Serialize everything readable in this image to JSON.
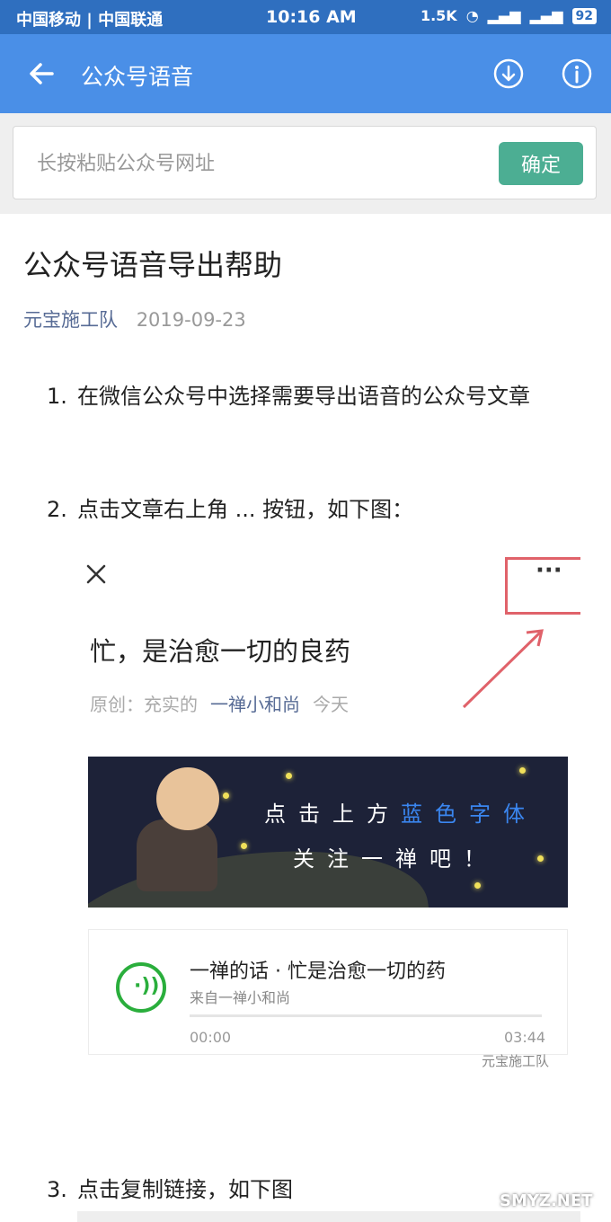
{
  "status": {
    "carrier": "中国移动 | 中国联通",
    "time": "10:16 AM",
    "net_speed": "1.5K",
    "battery": "92"
  },
  "appbar": {
    "title": "公众号语音"
  },
  "input": {
    "placeholder": "长按粘贴公众号网址",
    "value": "",
    "confirm_label": "确定"
  },
  "article": {
    "title": "公众号语音导出帮助",
    "author": "元宝施工队",
    "date": "2019-09-23",
    "steps": [
      {
        "num": "1.",
        "text": "在微信公众号中选择需要导出语音的公众号文章"
      },
      {
        "num": "2.",
        "text": "点击文章右上角 ... 按钮，如下图："
      },
      {
        "num": "3.",
        "text": "点击复制链接，如下图"
      }
    ]
  },
  "screenshot": {
    "title": "忙，是治愈一切的良药",
    "meta_prefix": "原创：充实的",
    "account": "一禅小和尚",
    "meta_suffix": "今天",
    "banner_line1_a": "点击上方",
    "banner_line1_b": "蓝色字体",
    "banner_line2": "关注一禅吧！",
    "audio_name": "一禅的话 · 忙是治愈一切的药",
    "audio_from": "来自一禅小和尚",
    "time_start": "00:00",
    "time_end": "03:44",
    "watermark": "元宝施工队",
    "more_label": "···"
  },
  "site_mark": "SMYZ.NET",
  "colors": {
    "appbar": "#4a8fe7",
    "statusbar": "#2f6fbf",
    "confirm": "#4cae93",
    "author": "#576b95",
    "highlight": "#e0626a"
  }
}
